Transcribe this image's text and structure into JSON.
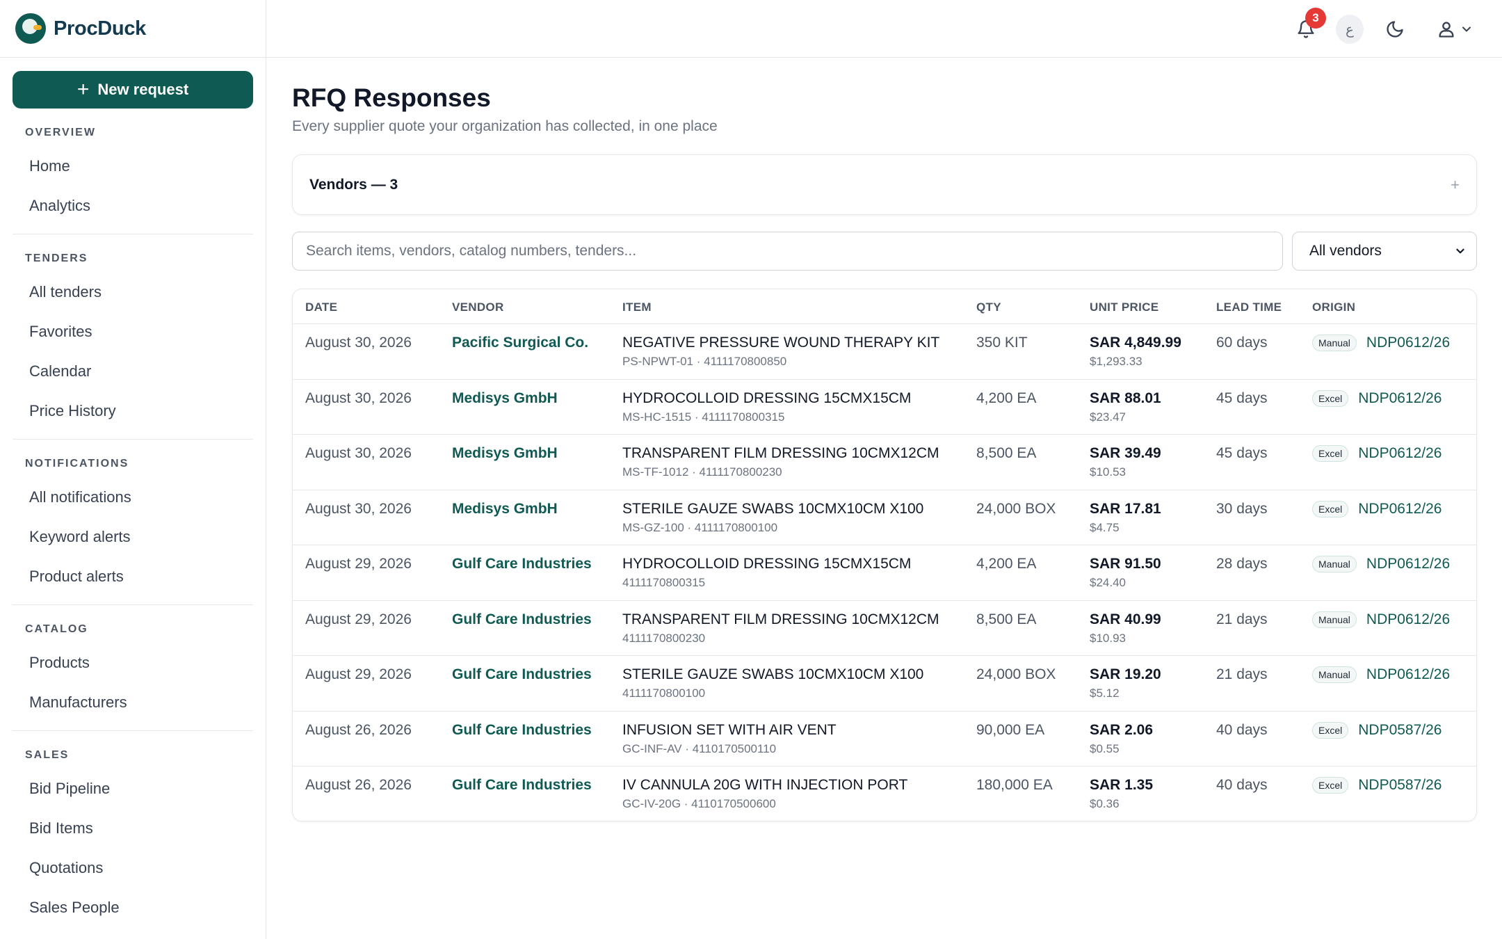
{
  "brand": {
    "name": "ProcDuck"
  },
  "sidebar": {
    "new_request_label": "New request",
    "sections": [
      {
        "title": "OVERVIEW",
        "items": [
          "Home",
          "Analytics"
        ]
      },
      {
        "title": "TENDERS",
        "items": [
          "All tenders",
          "Favorites",
          "Calendar",
          "Price History"
        ]
      },
      {
        "title": "NOTIFICATIONS",
        "items": [
          "All notifications",
          "Keyword alerts",
          "Product alerts"
        ]
      },
      {
        "title": "CATALOG",
        "items": [
          "Products",
          "Manufacturers"
        ]
      },
      {
        "title": "SALES",
        "items": [
          "Bid Pipeline",
          "Bid Items",
          "Quotations",
          "Sales People"
        ]
      }
    ]
  },
  "topbar": {
    "notification_count": "3",
    "language_glyph": "ع"
  },
  "page": {
    "title": "RFQ Responses",
    "subtitle": "Every supplier quote your organization has collected, in one place"
  },
  "vendors_panel": {
    "label": "Vendors — 3",
    "toggle": "+"
  },
  "search": {
    "placeholder": "Search items, vendors, catalog numbers, tenders..."
  },
  "vendor_filter": {
    "selected": "All vendors"
  },
  "table": {
    "columns": [
      "DATE",
      "VENDOR",
      "ITEM",
      "QTY",
      "UNIT PRICE",
      "LEAD TIME",
      "ORIGIN"
    ],
    "rows": [
      {
        "date": "August 30, 2026",
        "vendor": "Pacific Surgical Co.",
        "item": "NEGATIVE PRESSURE WOUND THERAPY KIT",
        "item_sub": "PS-NPWT-01 · 4111170800850",
        "qty": "350 KIT",
        "price_sar": "SAR 4,849.99",
        "price_usd": "$1,293.33",
        "lead": "60 days",
        "origin_tag": "Manual",
        "tender": "NDP0612/26"
      },
      {
        "date": "August 30, 2026",
        "vendor": "Medisys GmbH",
        "item": "HYDROCOLLOID DRESSING 15CMX15CM",
        "item_sub": "MS-HC-1515 · 4111170800315",
        "qty": "4,200 EA",
        "price_sar": "SAR 88.01",
        "price_usd": "$23.47",
        "lead": "45 days",
        "origin_tag": "Excel",
        "tender": "NDP0612/26"
      },
      {
        "date": "August 30, 2026",
        "vendor": "Medisys GmbH",
        "item": "TRANSPARENT FILM DRESSING 10CMX12CM",
        "item_sub": "MS-TF-1012 · 4111170800230",
        "qty": "8,500 EA",
        "price_sar": "SAR 39.49",
        "price_usd": "$10.53",
        "lead": "45 days",
        "origin_tag": "Excel",
        "tender": "NDP0612/26"
      },
      {
        "date": "August 30, 2026",
        "vendor": "Medisys GmbH",
        "item": "STERILE GAUZE SWABS 10CMX10CM X100",
        "item_sub": "MS-GZ-100 · 4111170800100",
        "qty": "24,000 BOX",
        "price_sar": "SAR 17.81",
        "price_usd": "$4.75",
        "lead": "30 days",
        "origin_tag": "Excel",
        "tender": "NDP0612/26"
      },
      {
        "date": "August 29, 2026",
        "vendor": "Gulf Care Industries",
        "item": "HYDROCOLLOID DRESSING 15CMX15CM",
        "item_sub": "4111170800315",
        "qty": "4,200 EA",
        "price_sar": "SAR 91.50",
        "price_usd": "$24.40",
        "lead": "28 days",
        "origin_tag": "Manual",
        "tender": "NDP0612/26"
      },
      {
        "date": "August 29, 2026",
        "vendor": "Gulf Care Industries",
        "item": "TRANSPARENT FILM DRESSING 10CMX12CM",
        "item_sub": "4111170800230",
        "qty": "8,500 EA",
        "price_sar": "SAR 40.99",
        "price_usd": "$10.93",
        "lead": "21 days",
        "origin_tag": "Manual",
        "tender": "NDP0612/26"
      },
      {
        "date": "August 29, 2026",
        "vendor": "Gulf Care Industries",
        "item": "STERILE GAUZE SWABS 10CMX10CM X100",
        "item_sub": "4111170800100",
        "qty": "24,000 BOX",
        "price_sar": "SAR 19.20",
        "price_usd": "$5.12",
        "lead": "21 days",
        "origin_tag": "Manual",
        "tender": "NDP0612/26"
      },
      {
        "date": "August 26, 2026",
        "vendor": "Gulf Care Industries",
        "item": "INFUSION SET WITH AIR VENT",
        "item_sub": "GC-INF-AV · 4110170500110",
        "qty": "90,000 EA",
        "price_sar": "SAR 2.06",
        "price_usd": "$0.55",
        "lead": "40 days",
        "origin_tag": "Excel",
        "tender": "NDP0587/26"
      },
      {
        "date": "August 26, 2026",
        "vendor": "Gulf Care Industries",
        "item": "IV CANNULA 20G WITH INJECTION PORT",
        "item_sub": "GC-IV-20G · 4110170500600",
        "qty": "180,000 EA",
        "price_sar": "SAR 1.35",
        "price_usd": "$0.36",
        "lead": "40 days",
        "origin_tag": "Excel",
        "tender": "NDP0587/26"
      }
    ]
  },
  "colors": {
    "accent": "#0f5a52",
    "badge": "#e53935"
  },
  "icons": [
    "duck-logo-icon",
    "plus-icon",
    "bell-icon",
    "language-icon",
    "moon-icon",
    "user-icon",
    "chevron-down-icon"
  ]
}
